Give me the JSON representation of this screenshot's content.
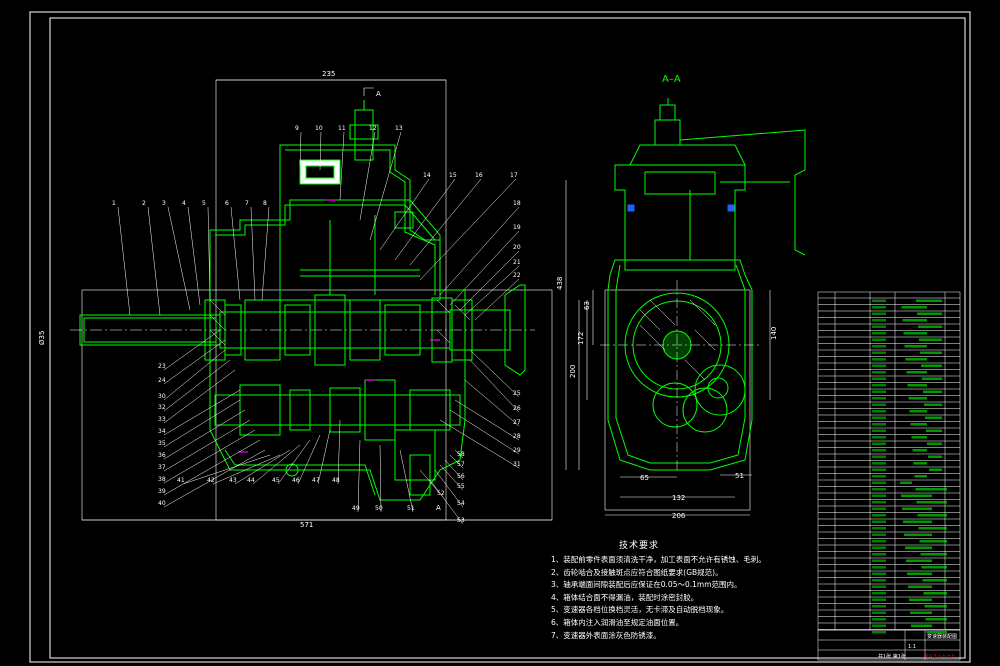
{
  "drawing": {
    "section_label": "A–A",
    "cut_marker": "A",
    "part_numbers": [
      "1",
      "2",
      "3",
      "4",
      "5",
      "6",
      "7",
      "8",
      "9",
      "10",
      "11",
      "12",
      "13",
      "14",
      "15",
      "16",
      "17",
      "18",
      "19",
      "20",
      "21",
      "22",
      "23",
      "24",
      "25",
      "26",
      "27",
      "28",
      "29",
      "30",
      "31",
      "32",
      "33",
      "34",
      "35",
      "36",
      "37",
      "38",
      "39",
      "40",
      "41",
      "42",
      "43",
      "44",
      "45",
      "46",
      "47",
      "48",
      "49",
      "50",
      "51",
      "52",
      "53",
      "54",
      "55",
      "56",
      "57",
      "58"
    ],
    "dimensions": {
      "overall_length": "571",
      "top_width": "235",
      "section_width": "206",
      "section_inner_width": "132",
      "section_height": "438",
      "offset_65": "65",
      "offset_51": "51",
      "height_140": "140",
      "height_63": "63",
      "height_200": "200",
      "height_172": "172",
      "shaft_diameter": "Ø35"
    }
  },
  "tech_notes": {
    "title": "技术要求",
    "items": [
      "1、装配前零件表面须清洗干净，加工表面不允许有锈蚀、毛刺。",
      "2、齿轮啮合及接触斑点应符合图纸要求(GB规范)。",
      "3、轴承端面间隙装配后应保证在0.05～0.1mm范围内。",
      "4、箱体结合面不得漏油，装配时涂密封胶。",
      "5、变速器各档位换档灵活，无卡滞及自动脱档现象。",
      "6、箱体内注入润滑油至规定油面位置。",
      "7、变速器外表面涂灰色防锈漆。"
    ]
  },
  "title_block": {
    "drawing_name": "变速器装配图",
    "scale": "1:1",
    "sheet": "共1张 第1张",
    "stamp": "P.V.3.a.h.b.f"
  },
  "colors": {
    "background": "#000000",
    "frame": "#ffffff",
    "part": "#00ff00",
    "leader": "#ffffff",
    "dimension": "#ffffff",
    "highlight": "#ff00ff",
    "stamp": "#ff0000",
    "accent_blue": "#2060ff"
  }
}
